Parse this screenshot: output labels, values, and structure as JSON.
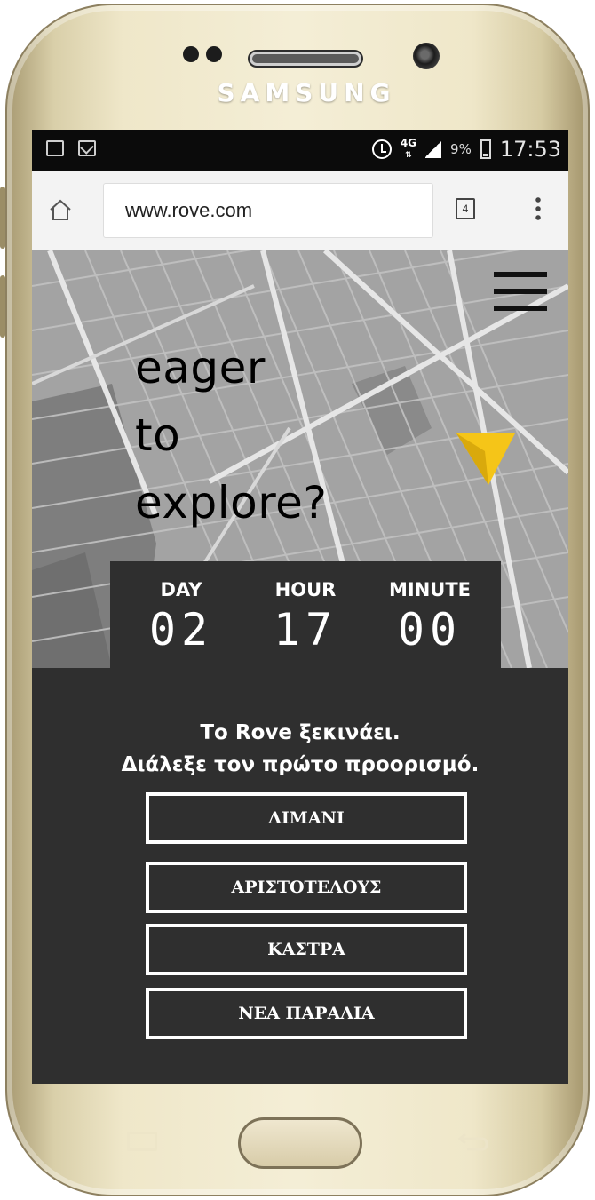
{
  "device": {
    "brand": "SAMSUNG"
  },
  "status_bar": {
    "network": "4G",
    "battery_percent": "9%",
    "time": "17:53",
    "icons": [
      "screenshot-icon",
      "mail-icon",
      "alarm-icon",
      "signal-icon",
      "battery-icon"
    ]
  },
  "browser": {
    "url": "www.rove.com",
    "tab_count": "4",
    "icons": [
      "home-icon",
      "tabs-icon",
      "overflow-menu-icon"
    ]
  },
  "hero": {
    "headline_lines": [
      "eager",
      "to",
      "explore?"
    ],
    "icons": [
      "hamburger-menu-icon",
      "location-marker-icon"
    ],
    "marker_color": "#f5c518"
  },
  "countdown": {
    "day_label": "DAY",
    "day_value": "02",
    "hour_label": "HOUR",
    "hour_value": "17",
    "minute_label": "MINUTE",
    "minute_value": "00"
  },
  "intro": {
    "line1": "Το Rove ξεκινάει.",
    "line2": "Διάλεξε τον πρώτο προορισμό."
  },
  "destinations": [
    {
      "label": "ΛΙΜΑΝΙ"
    },
    {
      "label": "ΑΡΙΣΤΟΤΕΛΟΥΣ"
    },
    {
      "label": "ΚΑΣΤΡΑ"
    },
    {
      "label": "ΝΕΑ ΠΑΡΑΛΙΑ"
    }
  ],
  "colors": {
    "panel_bg": "#2f2f2f",
    "map_gray": "#9c9c9c",
    "text_light": "#ffffff",
    "marker_yellow": "#f5c518"
  }
}
